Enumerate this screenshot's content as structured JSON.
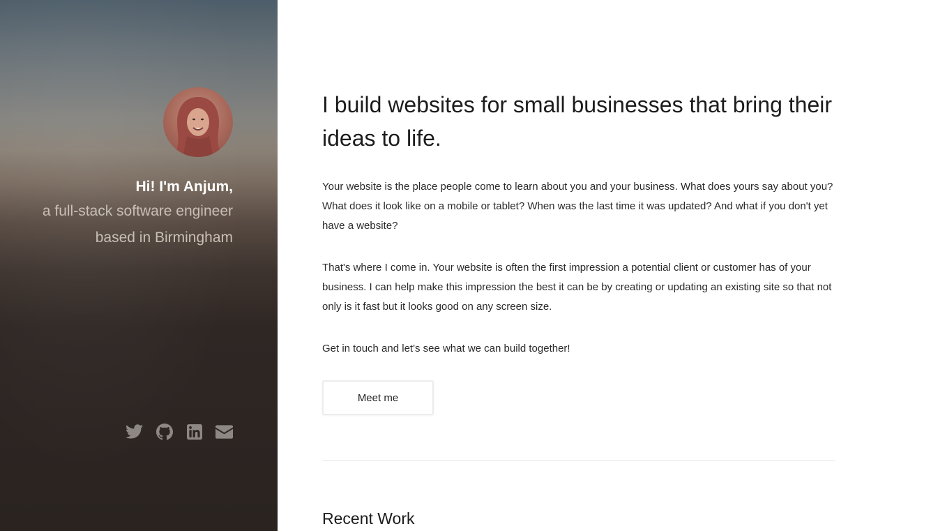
{
  "sidebar": {
    "greeting": "Hi! I'm Anjum,",
    "role_line_1": "a full-stack software engineer",
    "role_line_2": "based in Birmingham",
    "avatar_alt": "Anjum",
    "social_icons": [
      "twitter-icon",
      "github-icon",
      "linkedin-icon",
      "envelope-icon"
    ]
  },
  "main": {
    "headline": "I build websites for small businesses that bring their ideas to life.",
    "paragraphs": [
      "Your website is the place people come to learn about you and your business. What does yours say about you? What does it look like on a mobile or tablet? When was the last time it was updated? And what if you don't yet have a website?",
      "That's where I come in. Your website is often the first impression a potential client or customer has of your business. I can help make this impression the best it can be by creating or updating an existing site so that not only is it fast but it looks good on any screen size.",
      "Get in touch and let's see what we can build together!"
    ],
    "cta_label": "Meet me",
    "recent_work_title": "Recent Work"
  },
  "colors": {
    "sidebar_top": "#4d5d69",
    "sidebar_bottom": "#2a2320",
    "social_icon": "#8d8883",
    "greeting": "#ffffff",
    "role_text": "#c9bfb6"
  }
}
